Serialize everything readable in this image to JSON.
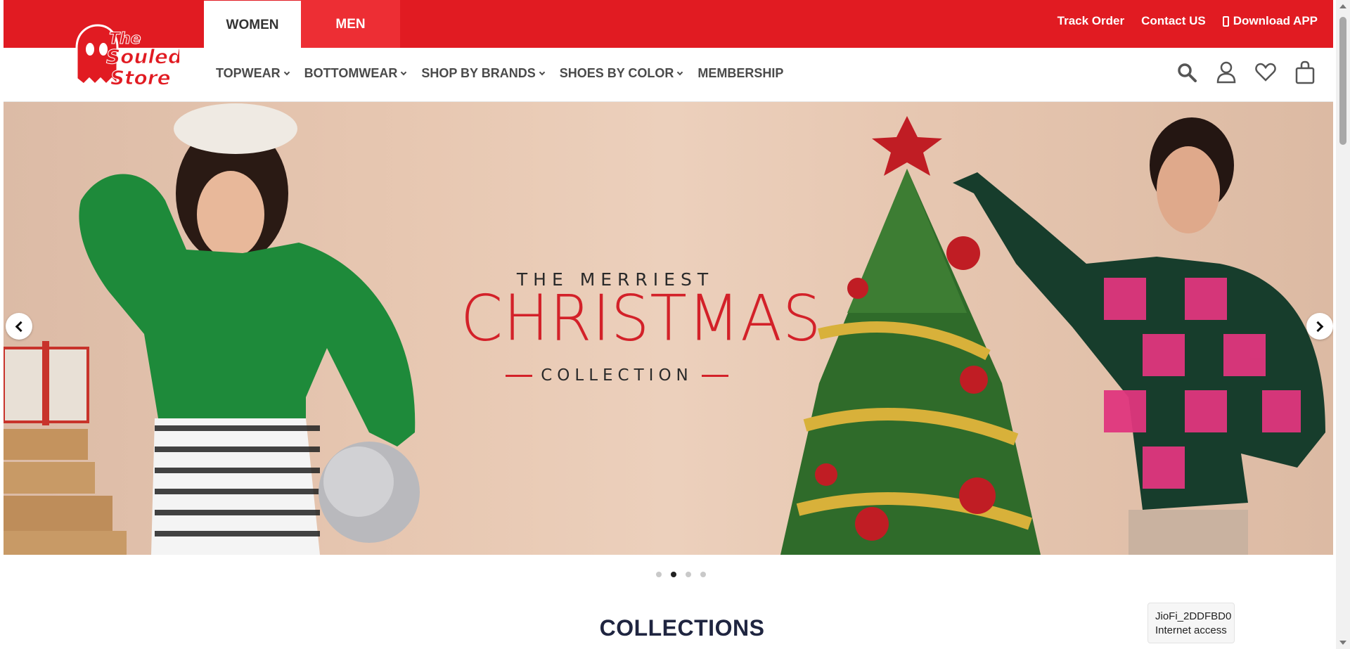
{
  "brand": {
    "logo_text": "The Souled Store",
    "primary_color": "#e11b22",
    "tab_inactive_color": "#ed2e34"
  },
  "gender_tabs": [
    {
      "label": "WOMEN",
      "active": true
    },
    {
      "label": "MEN",
      "active": false
    }
  ],
  "top_links": {
    "track_order": "Track Order",
    "contact_us": "Contact US",
    "download_app": "Download APP"
  },
  "nav": {
    "items": [
      {
        "label": "TOPWEAR",
        "has_dropdown": true
      },
      {
        "label": "BOTTOMWEAR",
        "has_dropdown": true
      },
      {
        "label": "SHOP BY BRANDS",
        "has_dropdown": true
      },
      {
        "label": "SHOES BY COLOR",
        "has_dropdown": true
      },
      {
        "label": "MEMBERSHIP",
        "has_dropdown": false
      }
    ]
  },
  "header_icons": [
    "search-icon",
    "user-icon",
    "heart-icon",
    "bag-icon"
  ],
  "hero": {
    "line1": "THE MERRIEST",
    "line2": "CHRISTMAS",
    "line3": "COLLECTION",
    "slide_count": 4,
    "active_slide": 2,
    "accent_color": "#d32129"
  },
  "section": {
    "title": "COLLECTIONS"
  },
  "network_toast": {
    "ssid": "JioFi_2DDFBD0",
    "status": "Internet access"
  }
}
